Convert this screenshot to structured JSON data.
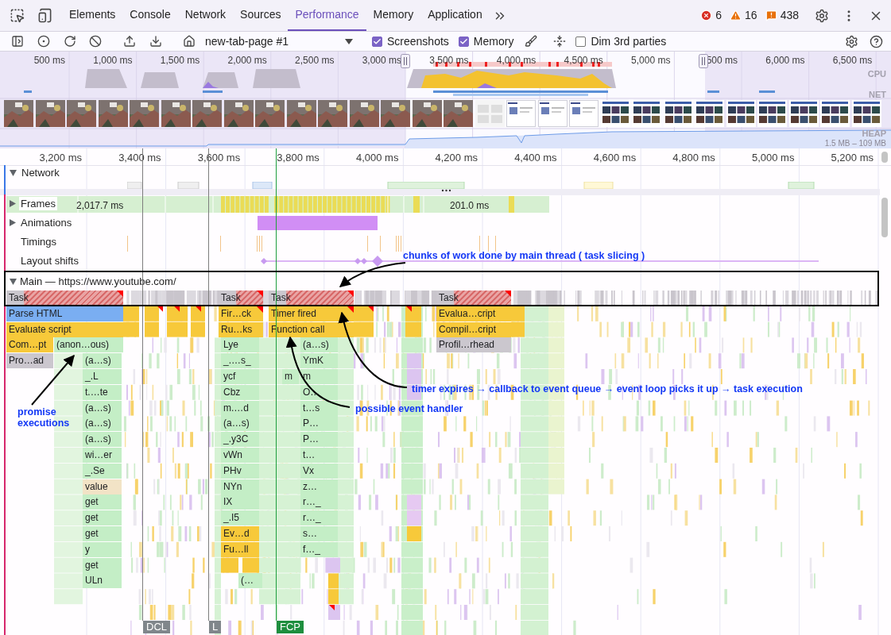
{
  "tabs": [
    {
      "label": "Elements",
      "selected": false
    },
    {
      "label": "Console",
      "selected": false
    },
    {
      "label": "Network",
      "selected": false
    },
    {
      "label": "Sources",
      "selected": false
    },
    {
      "label": "Performance",
      "selected": true
    },
    {
      "label": "Memory",
      "selected": false
    },
    {
      "label": "Application",
      "selected": false
    }
  ],
  "issue_counts": [
    {
      "kind": "error",
      "count": "6"
    },
    {
      "kind": "warning",
      "count": "16"
    },
    {
      "kind": "issue",
      "count": "438"
    }
  ],
  "toolbar": {
    "recording": "new-tab-page #1",
    "options": [
      {
        "label": "Screenshots",
        "checked": true
      },
      {
        "label": "Memory",
        "checked": true
      },
      {
        "label": "Dim 3rd parties",
        "checked": false
      }
    ]
  },
  "overview": {
    "ticks": [
      "500 ms",
      "1,000 ms",
      "1,500 ms",
      "2,000 ms",
      "2,500 ms",
      "3,000 ms",
      "3,500 ms",
      "4,000 ms",
      "4,500 ms",
      "5,000 ms",
      "500 ms",
      "6,000 ms",
      "6,500 ms"
    ],
    "tracks": [
      "CPU",
      "NET",
      "HEAP"
    ],
    "heap_range": "1.5 MB – 109 MB",
    "screenshots": [
      {
        "kind": "picture"
      },
      {
        "kind": "picture"
      },
      {
        "kind": "picture"
      },
      {
        "kind": "picture"
      },
      {
        "kind": "picture"
      },
      {
        "kind": "picture"
      },
      {
        "kind": "picture"
      },
      {
        "kind": "picture"
      },
      {
        "kind": "picture"
      },
      {
        "kind": "picture"
      },
      {
        "kind": "picture"
      },
      {
        "kind": "picture"
      },
      {
        "kind": "picture"
      },
      {
        "kind": "picture"
      },
      {
        "kind": "picture"
      },
      {
        "kind": "picture"
      },
      {
        "kind": "picture"
      },
      {
        "kind": "picture"
      },
      {
        "kind": "picture"
      },
      {
        "kind": "picture"
      },
      {
        "kind": "picture"
      },
      {
        "kind": "picture"
      },
      {
        "kind": "picture"
      },
      {
        "kind": "picture"
      },
      {
        "kind": "picture"
      },
      {
        "kind": "picture"
      },
      {
        "kind": "picture"
      },
      {
        "kind": "picture"
      }
    ]
  },
  "ruler": [
    "3,200 ms",
    "3,400 ms",
    "3,600 ms",
    "3,800 ms",
    "4,000 ms",
    "4,200 ms",
    "4,400 ms",
    "4,600 ms",
    "4,800 ms",
    "5,000 ms",
    "5,200 ms"
  ],
  "tracks": [
    {
      "label": "Network",
      "kind": "group",
      "expanded": true
    },
    {
      "label": "Frames",
      "kind": "group",
      "expanded": false
    },
    {
      "label": "Animations",
      "kind": "group",
      "expanded": false
    },
    {
      "label": "Timings",
      "kind": "plain"
    },
    {
      "label": "Layout shifts",
      "kind": "plain"
    }
  ],
  "frames": {
    "durations": [
      "2,017.7 ms",
      "201.0 ms"
    ]
  },
  "main": {
    "title": "Main — https://www.youtube.com/",
    "expanded": true,
    "rows": [
      {
        "entries": [
          {
            "label": "Task",
            "kind": "long-task",
            "warning": true
          },
          {
            "label": "Task",
            "kind": "long-task",
            "warning": true
          },
          {
            "label": "Task",
            "kind": "long-task",
            "warning": true
          },
          {
            "label": "Task",
            "kind": "long-task",
            "warning": true
          }
        ]
      },
      {
        "entries": [
          {
            "label": "Parse HTML",
            "kind": "parse",
            "warning": false
          },
          {
            "label": "Fir…ck",
            "kind": "script",
            "warning": true
          },
          {
            "label": "Timer fired",
            "kind": "script",
            "warning": true
          },
          {
            "label": "Evalua…cript",
            "kind": "script",
            "warning": false
          }
        ]
      },
      {
        "entries": [
          {
            "label": "Evaluate script",
            "kind": "script",
            "warning": false
          },
          {
            "label": "Ru…ks",
            "kind": "script",
            "warning": false
          },
          {
            "label": "Function call",
            "kind": "script",
            "warning": false
          },
          {
            "label": "Compil…cript",
            "kind": "script",
            "warning": false
          }
        ]
      },
      {
        "entries": [
          {
            "label": "Com…pt",
            "kind": "script",
            "warning": false
          },
          {
            "label": "(anon…ous)",
            "kind": "function",
            "warning": false
          },
          {
            "label": "Lye",
            "kind": "function",
            "warning": false
          },
          {
            "label": "(a…s)",
            "kind": "function",
            "warning": false
          },
          {
            "label": "Profil…rhead",
            "kind": "system",
            "warning": false
          }
        ]
      },
      {
        "entries": [
          {
            "label": "Pro…ad",
            "kind": "system",
            "warning": false
          },
          {
            "label": "(a…s)",
            "kind": "function",
            "warning": false
          },
          {
            "label": "_.…s_",
            "kind": "function",
            "warning": false
          },
          {
            "label": "YmK",
            "kind": "function",
            "warning": false
          }
        ]
      },
      {
        "entries": [
          {
            "label": "_.L",
            "kind": "function",
            "warning": false
          },
          {
            "label": "ycf",
            "kind": "function",
            "warning": false
          },
          {
            "label": "m",
            "kind": "function",
            "warning": false
          },
          {
            "label": "m",
            "kind": "function",
            "warning": false
          }
        ]
      },
      {
        "entries": [
          {
            "label": "t.…te",
            "kind": "function",
            "warning": false
          },
          {
            "label": "Cbz",
            "kind": "function",
            "warning": false
          },
          {
            "label": "O…",
            "kind": "function",
            "warning": false
          }
        ]
      },
      {
        "entries": [
          {
            "label": "(a…s)",
            "kind": "function",
            "warning": false
          },
          {
            "label": "m.…d",
            "kind": "function",
            "warning": false
          },
          {
            "label": "t…s",
            "kind": "function",
            "warning": false
          }
        ]
      },
      {
        "entries": [
          {
            "label": "(a…s)",
            "kind": "function",
            "warning": false
          },
          {
            "label": "(a…s)",
            "kind": "function",
            "warning": false
          },
          {
            "label": "P…",
            "kind": "function",
            "warning": false
          }
        ]
      },
      {
        "entries": [
          {
            "label": "(a…s)",
            "kind": "function",
            "warning": false
          },
          {
            "label": "_.y3C",
            "kind": "function",
            "warning": false
          },
          {
            "label": "P…",
            "kind": "function",
            "warning": false
          }
        ]
      },
      {
        "entries": [
          {
            "label": "wi…er",
            "kind": "function",
            "warning": false
          },
          {
            "label": "vWn",
            "kind": "function",
            "warning": false
          },
          {
            "label": "t…",
            "kind": "function",
            "warning": false
          }
        ]
      },
      {
        "entries": [
          {
            "label": "_.Se",
            "kind": "function",
            "warning": false
          },
          {
            "label": "PHv",
            "kind": "function",
            "warning": false
          },
          {
            "label": "Vx",
            "kind": "function",
            "warning": false
          }
        ]
      },
      {
        "entries": [
          {
            "label": "value",
            "kind": "runtime",
            "warning": false
          },
          {
            "label": "NYn",
            "kind": "function",
            "warning": false
          },
          {
            "label": "z…",
            "kind": "function",
            "warning": false
          }
        ]
      },
      {
        "entries": [
          {
            "label": "get",
            "kind": "function",
            "warning": false
          },
          {
            "label": "IX",
            "kind": "function",
            "warning": false
          },
          {
            "label": "r…_",
            "kind": "function",
            "warning": false
          }
        ]
      },
      {
        "entries": [
          {
            "label": "get",
            "kind": "function",
            "warning": false
          },
          {
            "label": "_.I5",
            "kind": "function",
            "warning": false
          },
          {
            "label": "r…_",
            "kind": "function",
            "warning": false
          }
        ]
      },
      {
        "entries": [
          {
            "label": "get",
            "kind": "function",
            "warning": false
          },
          {
            "label": "Ev…d",
            "kind": "script",
            "warning": false
          },
          {
            "label": "s…",
            "kind": "function",
            "warning": false
          }
        ]
      },
      {
        "entries": [
          {
            "label": "y",
            "kind": "function",
            "warning": false
          },
          {
            "label": "Fu…ll",
            "kind": "script",
            "warning": false
          },
          {
            "label": "f…_",
            "kind": "function",
            "warning": false
          }
        ]
      },
      {
        "entries": [
          {
            "label": "get",
            "kind": "function",
            "warning": false
          }
        ]
      },
      {
        "entries": [
          {
            "label": "ULn",
            "kind": "function",
            "warning": false
          },
          {
            "label": "(…",
            "kind": "function",
            "warning": false
          }
        ]
      }
    ]
  },
  "markers": [
    {
      "label": "DCL",
      "kind": "dcl"
    },
    {
      "label": "L",
      "kind": "load"
    },
    {
      "label": "FCP",
      "kind": "paint"
    }
  ],
  "annotations": [
    "chunks of work done by main thread ( task slicing )",
    "timer expires → callback to event queue → event loop picks it up → task execution",
    "promise executions",
    "possible event handler"
  ]
}
